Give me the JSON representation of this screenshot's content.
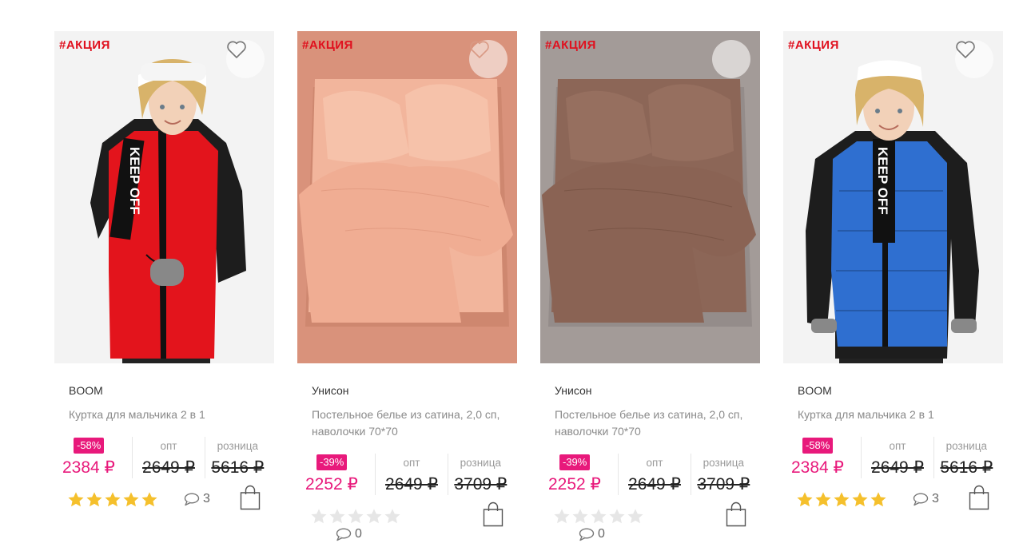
{
  "products": [
    {
      "promo": "#АКЦИЯ",
      "brand": "BOOM",
      "title": "Куртка для мальчика 2 в 1",
      "discount": "-58%",
      "sale_price": "2384 ₽",
      "opt_label": "опт",
      "opt_price": "2649 ₽",
      "retail_label": "розница",
      "retail_price": "5616 ₽",
      "rating": 5,
      "comments": "3",
      "image": "boy-red-vest-photo"
    },
    {
      "promo": "#АКЦИЯ",
      "brand": "Унисон",
      "title": "Постельное белье из сатина, 2,0 сп, наволочки 70*70",
      "discount": "-39%",
      "sale_price": "2252 ₽",
      "opt_label": "опт",
      "opt_price": "2649 ₽",
      "retail_label": "розница",
      "retail_price": "3709 ₽",
      "rating": 0,
      "comments": "0",
      "image": "peach-bedding-photo"
    },
    {
      "promo": "#АКЦИЯ",
      "brand": "Унисон",
      "title": "Постельное белье из сатина, 2,0 сп, наволочки 70*70",
      "discount": "-39%",
      "sale_price": "2252 ₽",
      "opt_label": "опт",
      "opt_price": "2649 ₽",
      "retail_label": "розница",
      "retail_price": "3709 ₽",
      "rating": 0,
      "comments": "0",
      "image": "brown-bedding-photo"
    },
    {
      "promo": "#АКЦИЯ",
      "brand": "BOOM",
      "title": "Куртка для мальчика 2 в 1",
      "discount": "-58%",
      "sale_price": "2384 ₽",
      "opt_label": "опт",
      "opt_price": "2649 ₽",
      "retail_label": "розница",
      "retail_price": "5616 ₽",
      "rating": 5,
      "comments": "3",
      "image": "boy-blue-vest-photo"
    }
  ],
  "vest_print": "KEEP OFF",
  "colors": {
    "promo": "#e0101e",
    "accent_pink": "#e8197b",
    "star_filled": "#f5c02c",
    "star_empty": "#e6e6e6",
    "peach_bg": "#d9927b",
    "brown_bg": "#a39b98"
  },
  "icons": {
    "favorite": "heart-outline-icon",
    "comments": "speech-bubble-icon",
    "cart": "shopping-bag-icon",
    "rating": "star-icon"
  }
}
